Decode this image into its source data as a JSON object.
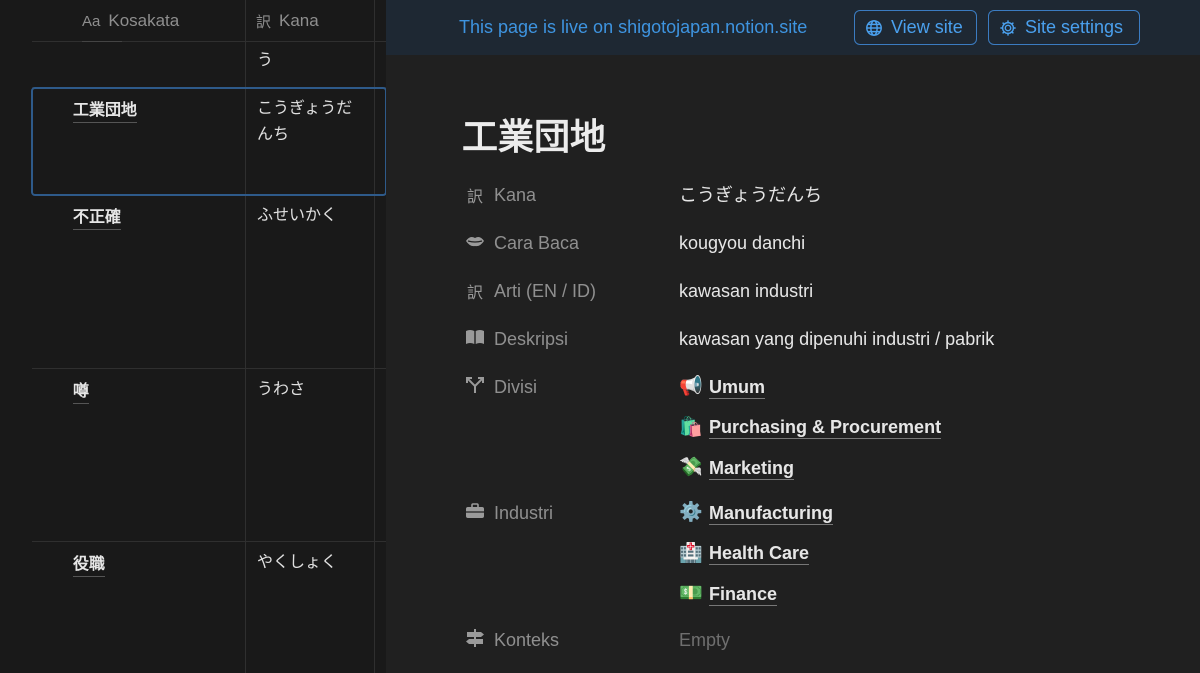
{
  "table": {
    "headers": [
      {
        "label": "Kosakata",
        "icon": "Aa"
      },
      {
        "label": "Kana",
        "icon": "訳"
      }
    ],
    "partial_row_kana": "う",
    "rows": [
      {
        "name": "工業団地",
        "kana": "こうぎょうだんち"
      },
      {
        "name": "不正確",
        "kana": "ふせいかく"
      },
      {
        "name": "噂",
        "kana": "うわさ"
      },
      {
        "name": "役職",
        "kana": "やくしょく"
      }
    ]
  },
  "topbar": {
    "live_text": "This page is live on shigotojapan.notion.site",
    "view_site": "View site",
    "site_settings": "Site settings"
  },
  "page": {
    "title": "工業団地",
    "properties": {
      "kana": {
        "label": "Kana",
        "value": "こうぎょうだんち",
        "icon": "translate-icon"
      },
      "cara_baca": {
        "label": "Cara Baca",
        "value": "kougyou danchi",
        "icon": "lips-icon"
      },
      "arti": {
        "label": "Arti (EN / ID)",
        "value": "kawasan industri",
        "icon": "translate-icon"
      },
      "deskripsi": {
        "label": "Deskripsi",
        "value": "kawasan yang dipenuhi industri / pabrik",
        "icon": "book-icon"
      },
      "divisi": {
        "label": "Divisi",
        "icon": "branch-icon",
        "tags": [
          {
            "emoji": "📢",
            "label": "Umum"
          },
          {
            "emoji": "🛍️",
            "label": "Purchasing & Procurement"
          },
          {
            "emoji": "💸",
            "label": "Marketing"
          }
        ]
      },
      "industri": {
        "label": "Industri",
        "icon": "briefcase-icon",
        "tags": [
          {
            "emoji": "⚙️",
            "label": "Manufacturing"
          },
          {
            "emoji": "🏥",
            "label": "Health Care"
          },
          {
            "emoji": "💵",
            "label": "Finance"
          }
        ]
      },
      "konteks": {
        "label": "Konteks",
        "value": "Empty",
        "icon": "signpost-icon"
      }
    }
  },
  "colors": {
    "accent": "#3e94e0",
    "background": "#191919",
    "panel": "#202020"
  }
}
